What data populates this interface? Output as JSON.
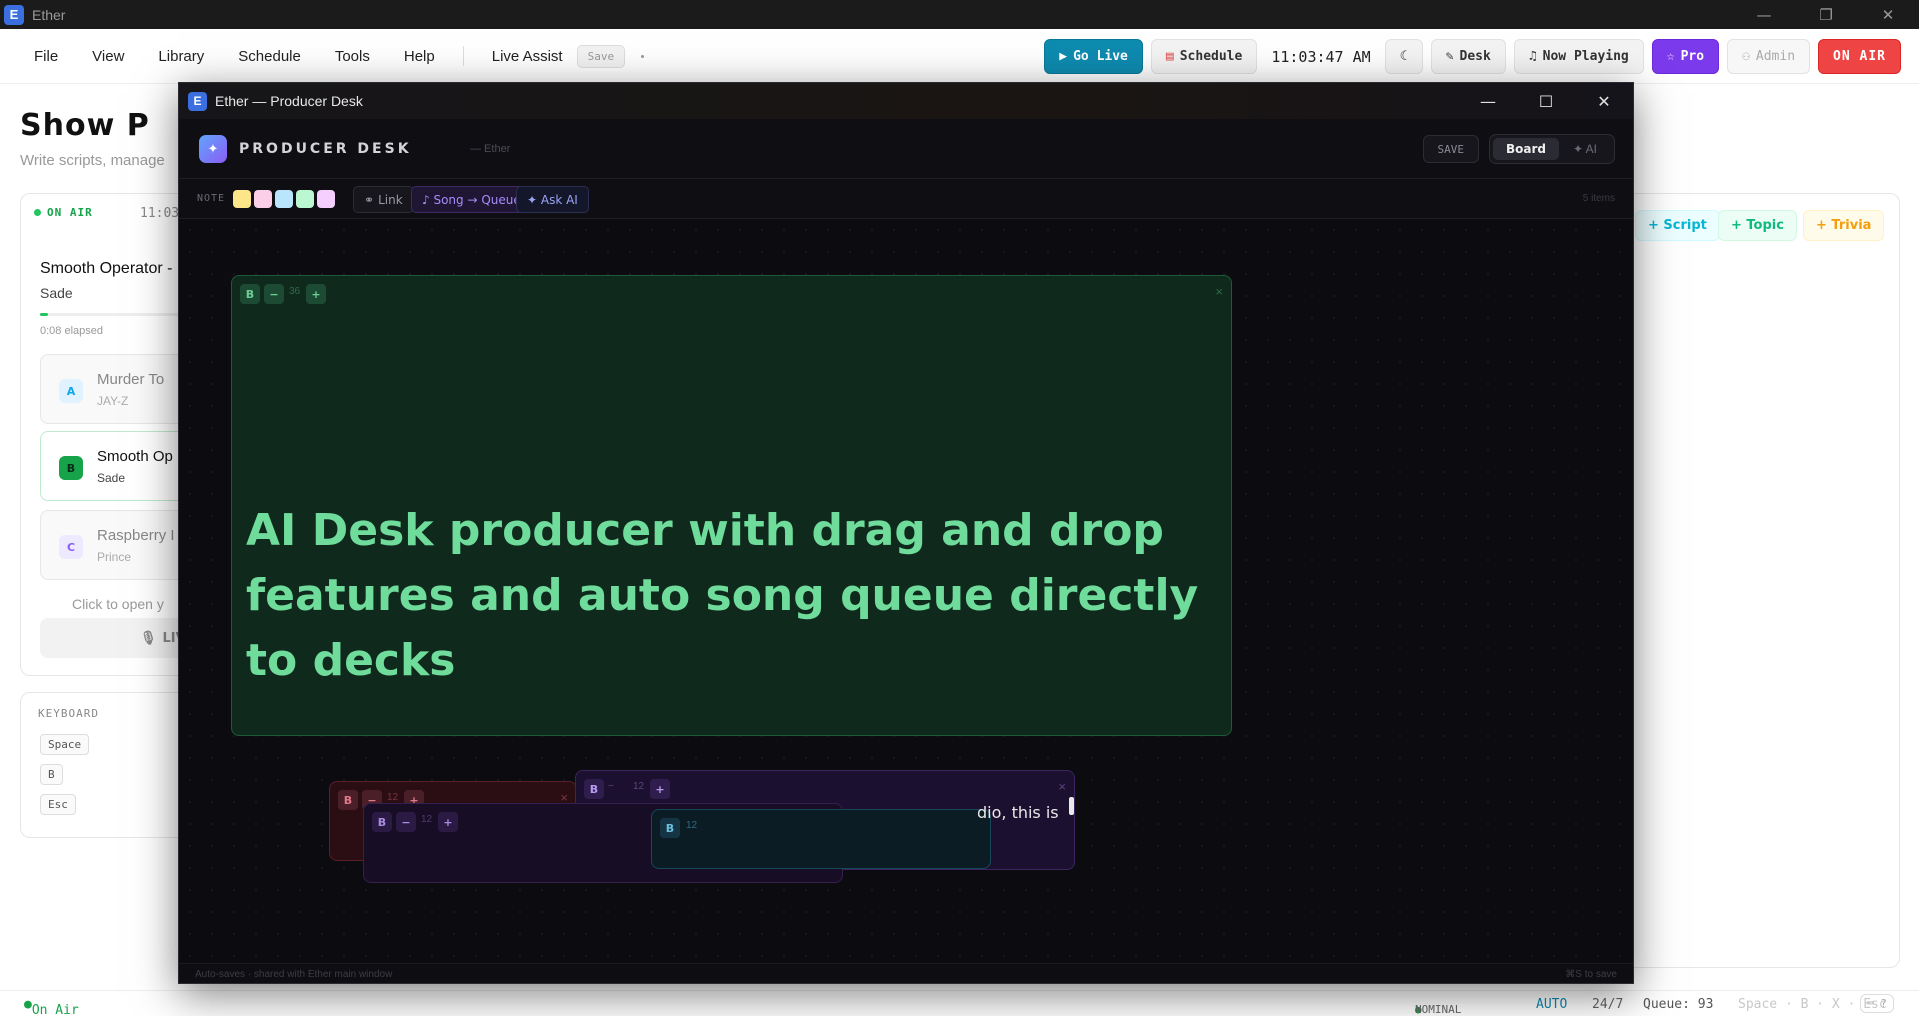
{
  "app": {
    "title": "Ether",
    "logo_letter": "E"
  },
  "window_controls": {
    "minimize": "—",
    "restore": "❐",
    "close": "✕"
  },
  "menu": {
    "items": [
      "File",
      "View",
      "Library",
      "Schedule",
      "Tools",
      "Help"
    ],
    "live_assist": "Live Assist",
    "save": "Save"
  },
  "toolbar": {
    "go_live": "Go Live",
    "schedule": "Schedule",
    "clock": "11:03:47 AM",
    "desk": "Desk",
    "now_playing": "Now Playing",
    "pro": "Pro",
    "admin": "Admin",
    "on_air": "ON AIR"
  },
  "page": {
    "title": "Show P",
    "subtitle": "Write scripts, manage"
  },
  "now_playing_panel": {
    "status": "ON AIR",
    "time": "11:03",
    "title": "Smooth Operator -",
    "artist": "Sade",
    "elapsed": "0:08 elapsed",
    "progress": 0.06,
    "queue": [
      {
        "badge": "A",
        "title": "Murder To",
        "artist": "JAY-Z"
      },
      {
        "badge": "B",
        "title": "Smooth Op",
        "artist": "Sade"
      },
      {
        "badge": "C",
        "title": "Raspberry I",
        "artist": "Prince"
      }
    ],
    "click_hint": "Click to open y",
    "live_button": "LIV"
  },
  "keyboard": {
    "title": "KEYBOARD",
    "keys": [
      "Space",
      "B",
      "Esc"
    ]
  },
  "chips": {
    "script": "+ Script",
    "topic": "+ Topic",
    "trivia": "+ Trivia"
  },
  "statusbar": {
    "on_air": "On Air",
    "nominal": "NOMINAL",
    "auto": "AUTO",
    "schedule": "24/7",
    "queue": "Queue: 93",
    "shortcuts": "Space · B · X · Esc",
    "help": "⌨ ?"
  },
  "desk": {
    "window_title": "Ether — Producer Desk",
    "name": "PRODUCER DESK",
    "subtitle": "— Ether",
    "save": "SAVE",
    "mode_board": "Board",
    "mode_ai": "✦ AI",
    "note_label": "NOTE",
    "swatch_colors": [
      "#fde68a",
      "#fbcfe8",
      "#bae6fd",
      "#bbf7d0",
      "#f5d0fe"
    ],
    "link": "Link",
    "song_queue": "♪ Song → Queue",
    "ask_ai": "✦ Ask AI",
    "items_count": "5 items",
    "footer_left": "Auto-saves · shared with Ether main window",
    "footer_right": "⌘S to save",
    "notes": {
      "main": {
        "bold": "B",
        "minus": "−",
        "size": "36",
        "plus": "+",
        "close": "×",
        "text": "AI Desk producer with drag and drop features and auto song queue directly to decks"
      },
      "red": {
        "bold": "B",
        "minus": "−",
        "size": "12",
        "plus": "+",
        "close": "×"
      },
      "purple": {
        "bold": "B",
        "minus": "−",
        "size": "12",
        "plus": "+",
        "close": "×",
        "text": "dio, this is"
      },
      "purple2": {
        "bold": "B",
        "minus": "−",
        "size": "12",
        "plus": "+"
      },
      "cyan": {
        "bold": "B",
        "size": "12"
      }
    }
  }
}
